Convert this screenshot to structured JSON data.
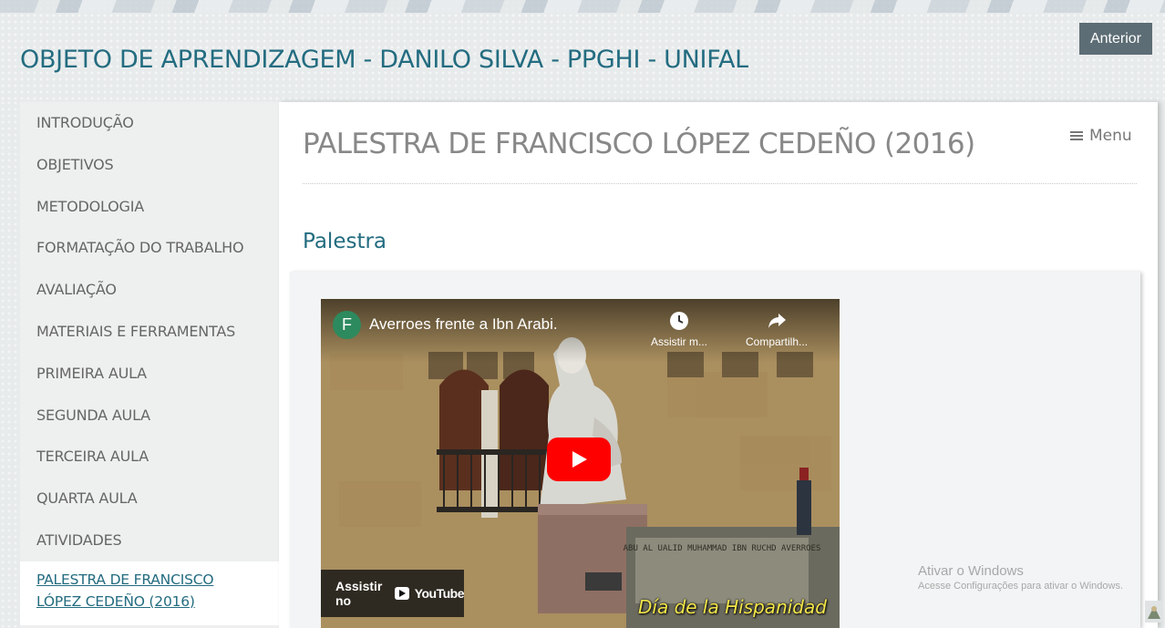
{
  "header": {
    "site_title": "OBJETO DE APRENDIZAGEM - DANILO SILVA - PPGHI - UNIFAL",
    "anterior_label": "Anterior"
  },
  "sidebar": {
    "items": [
      {
        "label": "INTRODUÇÃO"
      },
      {
        "label": "OBJETIVOS"
      },
      {
        "label": "METODOLOGIA"
      },
      {
        "label": "FORMATAÇÃO DO TRABALHO"
      },
      {
        "label": "AVALIAÇÃO"
      },
      {
        "label": "MATERIAIS E FERRAMENTAS"
      },
      {
        "label": "PRIMEIRA AULA"
      },
      {
        "label": "SEGUNDA AULA"
      },
      {
        "label": "TERCEIRA AULA"
      },
      {
        "label": "QUARTA AULA"
      },
      {
        "label": "ATIVIDADES"
      },
      {
        "label": "PALESTRA DE FRANCISCO LÓPEZ CEDEÑO (2016)",
        "active": true
      }
    ]
  },
  "main": {
    "page_title": "PALESTRA DE FRANCISCO LÓPEZ CEDEÑO (2016)",
    "menu_label": "Menu",
    "section_heading": "Palestra"
  },
  "video": {
    "channel_initial": "F",
    "title": "Averroes frente a Ibn Arabi.",
    "watch_later_label": "Assistir m...",
    "share_label": "Compartilh...",
    "watch_on_label": "Assistir no",
    "youtube_wordmark": "YouTube",
    "caption": "Día de la Hispanidad",
    "plaque_text": "ABU AL UALID MUHAMMAD IBN RUCHD AVERROES"
  },
  "windows_watermark": {
    "line1": "Ativar o Windows",
    "line2": "Acesse Configurações para ativar o Windows."
  },
  "colors": {
    "accent": "#236c80",
    "anterior_bg": "#5d6d75",
    "youtube_red": "#ff0000"
  }
}
